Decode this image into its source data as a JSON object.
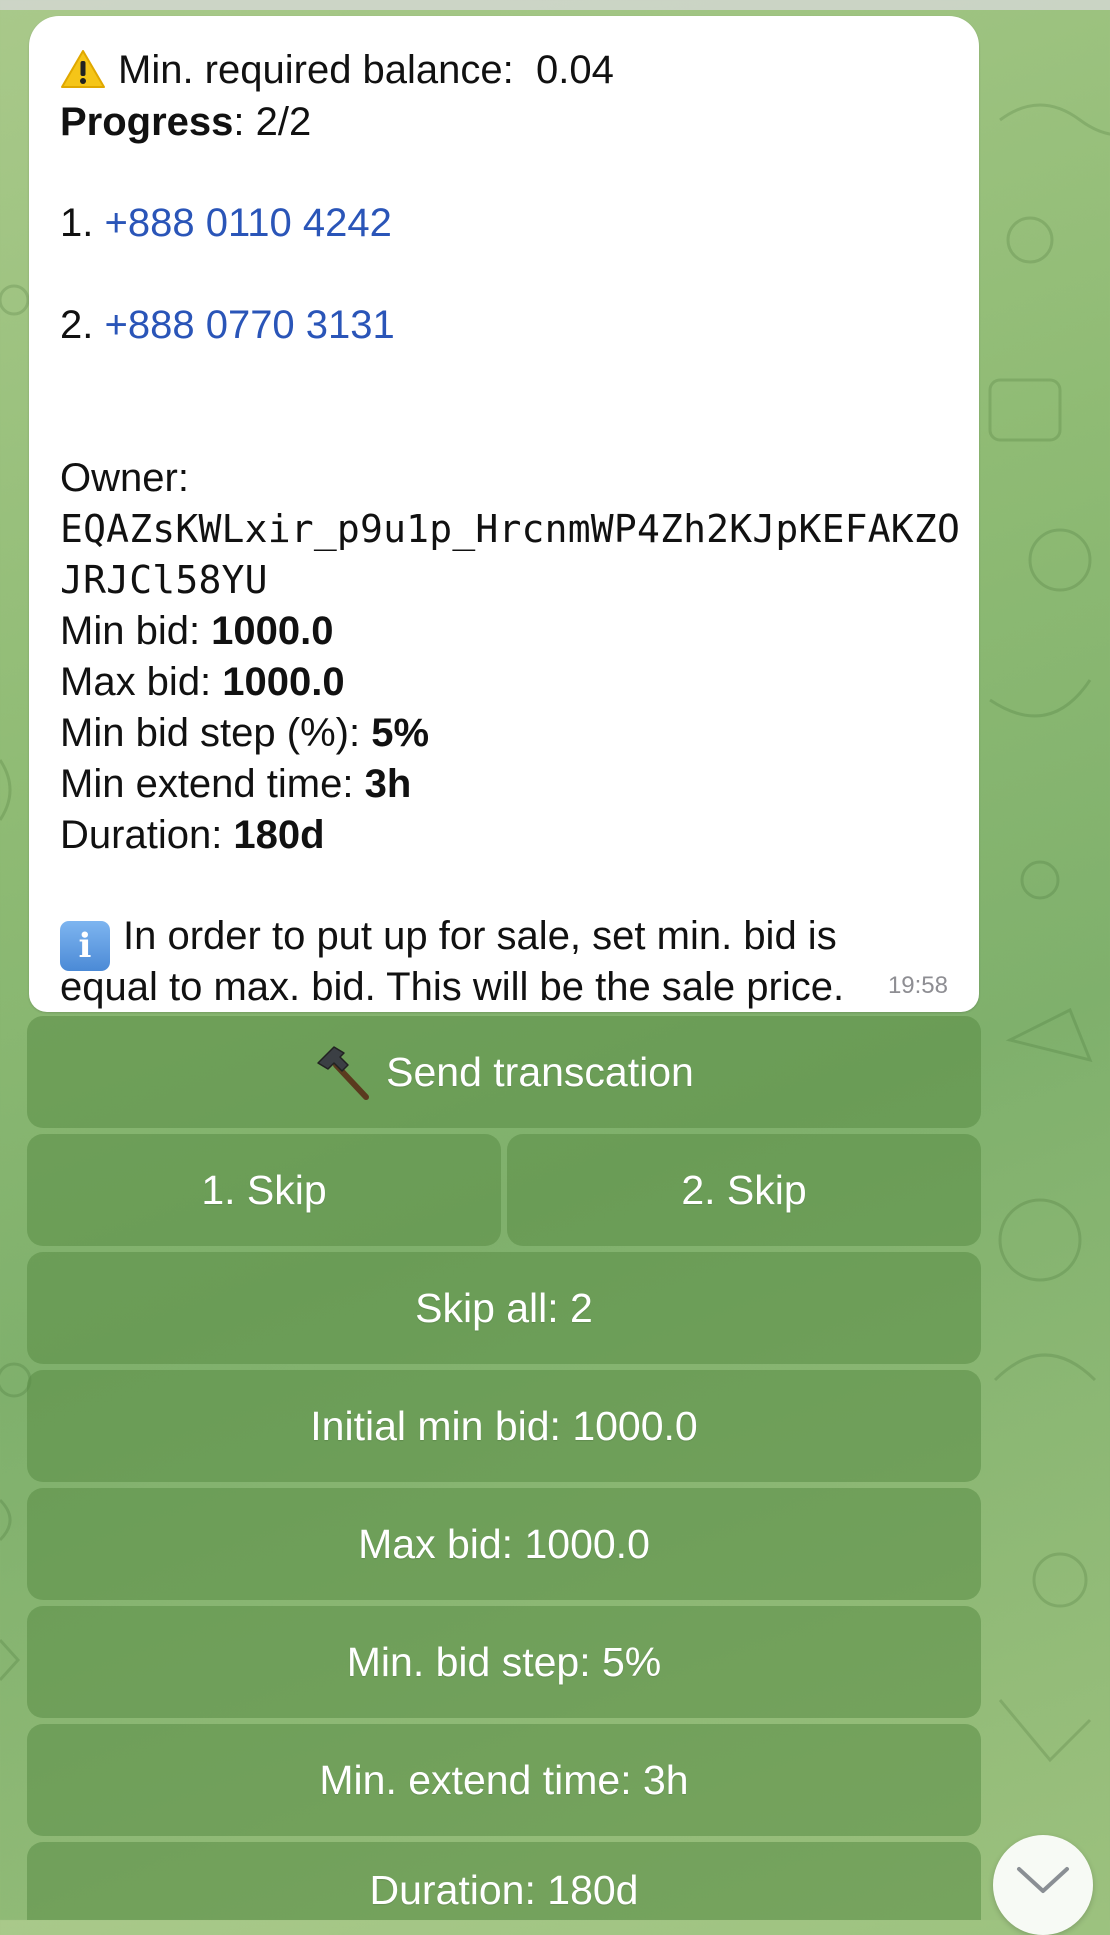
{
  "message": {
    "warning": {
      "label": "Min. required balance:",
      "value": "0.04"
    },
    "progress": {
      "label": "Progress",
      "value": ": 2/2"
    },
    "numbers": [
      {
        "index": "1.",
        "phone": "+888 0110 4242"
      },
      {
        "index": "2.",
        "phone": "+888 0770 3131"
      }
    ],
    "owner": {
      "label": "Owner:",
      "address_line1": "EQAZsKWLxir_p9u1p_HrcnmWP4Zh2KJpKEFAKZO",
      "address_line2": "JRJCl58YU"
    },
    "params": [
      {
        "label": "Min bid: ",
        "value": "1000.0"
      },
      {
        "label": "Max bid: ",
        "value": "1000.0"
      },
      {
        "label": "Min bid step (%): ",
        "value": "5%"
      },
      {
        "label": "Min extend time: ",
        "value": "3h"
      },
      {
        "label": "Duration: ",
        "value": "180d"
      }
    ],
    "info": {
      "line1": "In order to put up for sale, set min. bid is",
      "line2": "equal to max. bid. This will be the sale price."
    },
    "time": "19:58"
  },
  "keyboard": {
    "send": "Send transcation",
    "skip1": "1. Skip",
    "skip2": "2. Skip",
    "skip_all": "Skip all: 2",
    "initial_min_bid": "Initial min bid: 1000.0",
    "max_bid": "Max bid: 1000.0",
    "min_bid_step": "Min. bid step: 5%",
    "min_extend_time": "Min. extend time: 3h",
    "duration": "Duration: 180d"
  },
  "icons": {
    "warning": "warning-icon",
    "info": "info-icon",
    "hammer": "hammer-icon",
    "scroll_down": "chevron-down-icon"
  },
  "colors": {
    "link": "#2a55b8",
    "bubble": "#ffffff",
    "button": "#5a8c46"
  }
}
